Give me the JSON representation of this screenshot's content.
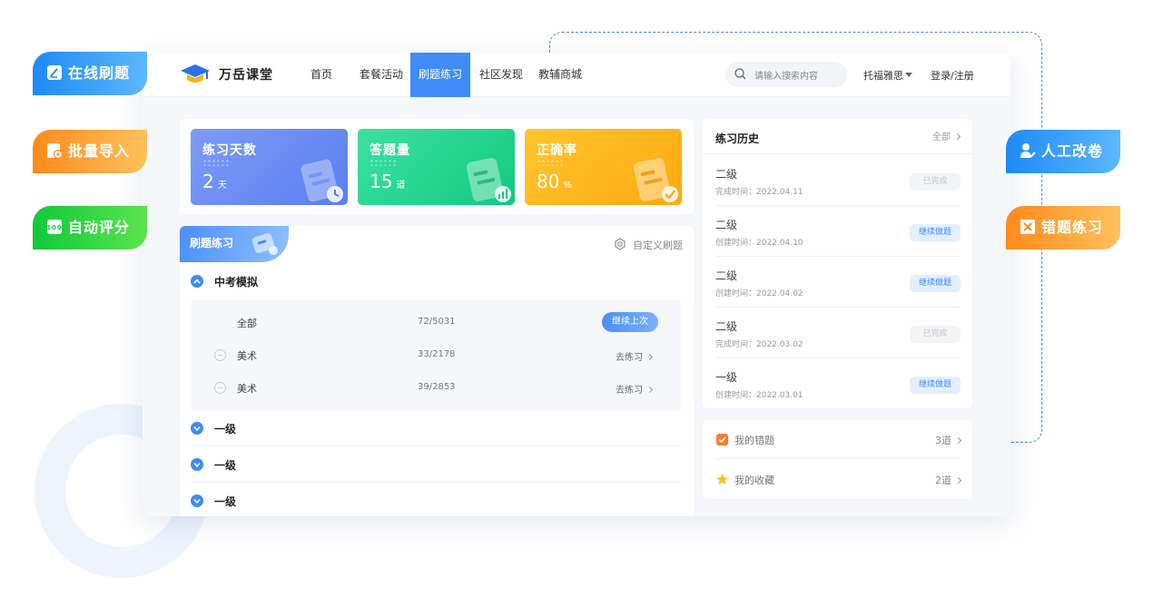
{
  "nav": {
    "brand": "万岳课堂",
    "items": [
      "首页",
      "套餐活动",
      "刷题练习",
      "社区发现",
      "教辅商城"
    ],
    "search_placeholder": "请输入搜索内容",
    "exam_type": "托福雅思",
    "login": "登录/注册"
  },
  "stats": [
    {
      "title": "练习天数",
      "value": "2",
      "unit": "天"
    },
    {
      "title": "答题量",
      "value": "15",
      "unit": "道"
    },
    {
      "title": "正确率",
      "value": "80",
      "unit": "%"
    }
  ],
  "practice": {
    "tab_label": "刷题练习",
    "custom_label": "自定义刷题",
    "group_open": "中考模拟",
    "sub_items": [
      {
        "name": "全部",
        "count": "72/5031",
        "action": "继续上次"
      },
      {
        "name": "美术",
        "count": "33/2178",
        "action": "去练习"
      },
      {
        "name": "美术",
        "count": "39/2853",
        "action": "去练习"
      }
    ],
    "groups_closed": [
      "一级",
      "一级",
      "一级"
    ]
  },
  "history": {
    "title": "练习历史",
    "all_label": "全部",
    "items": [
      {
        "level": "二级",
        "time": "完成时间：2022.04.11",
        "status": "已完成"
      },
      {
        "level": "二级",
        "time": "创建时间：2022.04.10",
        "status": "继续做题"
      },
      {
        "level": "二级",
        "time": "创建时间：2022.04.02",
        "status": "继续做题"
      },
      {
        "level": "二级",
        "time": "完成时间：2022.03.02",
        "status": "已完成"
      },
      {
        "level": "一级",
        "time": "创建时间：2022.03.01",
        "status": "继续做题"
      }
    ]
  },
  "mine": [
    {
      "label": "我的错题",
      "count": "3道"
    },
    {
      "label": "我的收藏",
      "count": "2道"
    }
  ],
  "tags": {
    "online": "在线刷题",
    "import": "批量导入",
    "auto": "自动评分",
    "manual": "人工改卷",
    "wrong": "错题练习"
  },
  "colors": {
    "primary": "#3f8cf7",
    "green_card": "#12c981",
    "orange_card": "#ffa90f",
    "tag_orange": "#ff8a1c",
    "tag_green": "#10c93a"
  }
}
